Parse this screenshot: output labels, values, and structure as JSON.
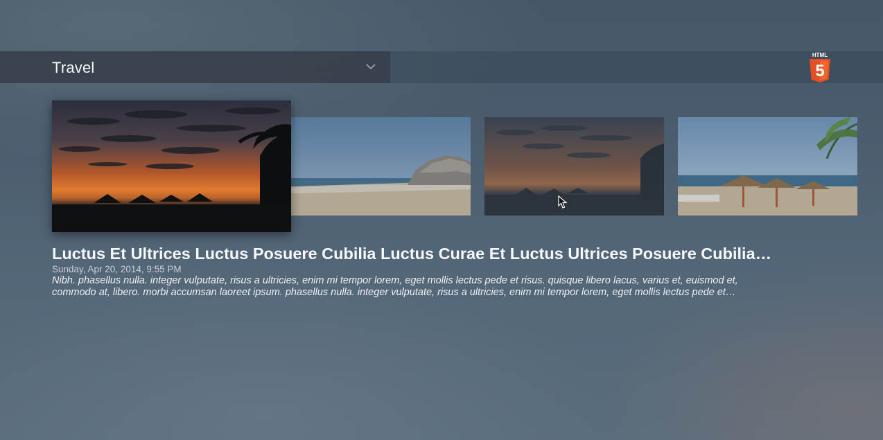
{
  "category": {
    "selected": "Travel",
    "chevron_icon": "chevron-down-icon"
  },
  "logo": {
    "text": "HTML",
    "badge_number": "5",
    "icon": "html5-logo-icon",
    "color": "#e34f26"
  },
  "gallery": {
    "thumbnails": [
      {
        "scene": "sunset-palms",
        "selected": true
      },
      {
        "scene": "beach-rock",
        "selected": false
      },
      {
        "scene": "sunset-palms-dim",
        "selected": false
      },
      {
        "scene": "beach-umbrellas",
        "selected": false
      }
    ]
  },
  "item": {
    "title": "Luctus Et Ultrices Luctus Posuere Cubilia Luctus Curae Et Luctus Ultrices Posuere Cubilia…",
    "date": "Sunday, Apr 20, 2014, 9:55 PM",
    "description": "Nibh. phasellus nulla. integer vulputate, risus a ultricies, enim mi tempor lorem, eget mollis lectus pede et risus. quisque libero lacus, varius et, euismod et, commodo at, libero. morbi accumsan laoreet ipsum. phasellus nulla. integer vulputate, risus a ultricies, enim mi tempor lorem, eget mollis lectus pede et…"
  }
}
